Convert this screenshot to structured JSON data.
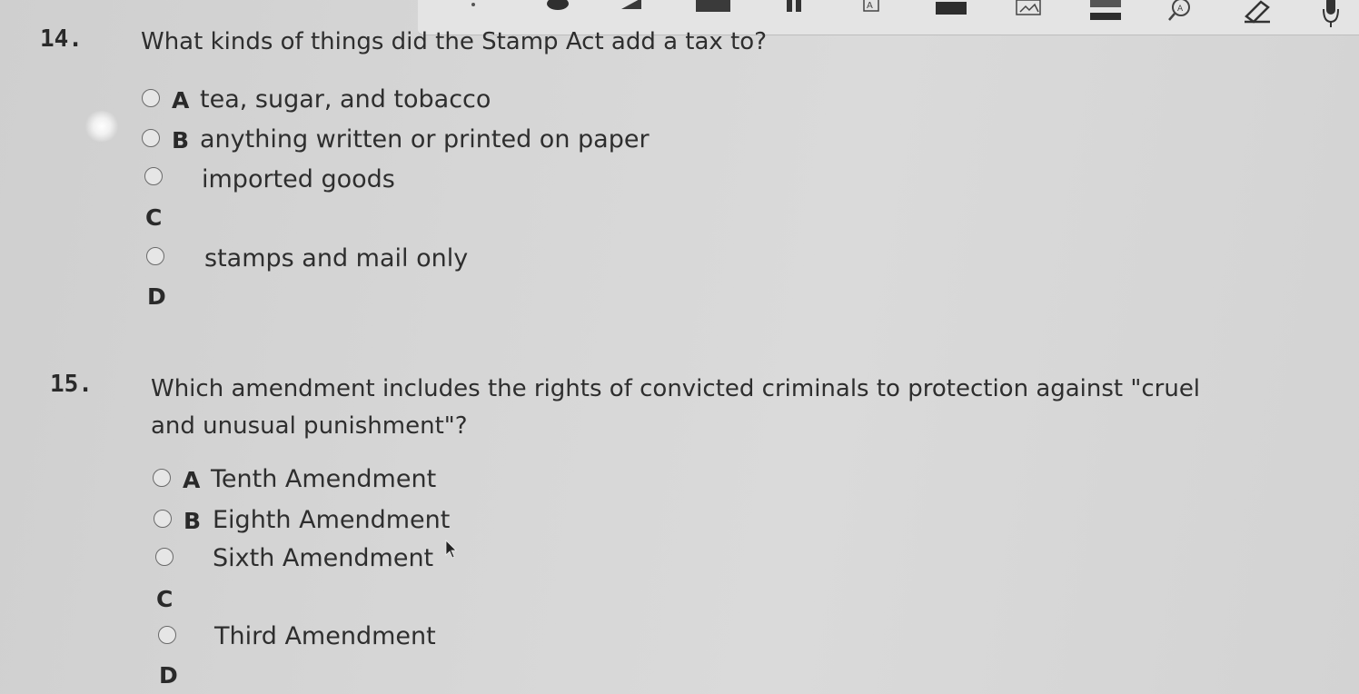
{
  "toolbar": {
    "icons": [
      "pointer-icon",
      "play-icon",
      "highlight-bar-icon",
      "pause-icon",
      "text-box-icon",
      "image-block-icon",
      "image-icon",
      "strikeout-icon",
      "magnify-icon",
      "eraser-pen-icon",
      "microphone-icon"
    ]
  },
  "questions": [
    {
      "number": "14.",
      "text": "What kinds of things did the Stamp Act add a tax to?",
      "options": [
        {
          "letter": "A",
          "text": "tea, sugar, and tobacco"
        },
        {
          "letter": "B",
          "text": "anything written or printed on paper"
        },
        {
          "letter": "C",
          "text": "imported goods"
        },
        {
          "letter": "D",
          "text": "stamps and mail only"
        }
      ]
    },
    {
      "number": "15.",
      "text_line1": "Which amendment includes the rights of convicted criminals to protection against \"cruel",
      "text_line2": "and unusual punishment\"?",
      "options": [
        {
          "letter": "A",
          "text": "Tenth Amendment"
        },
        {
          "letter": "B",
          "text": "Eighth Amendment"
        },
        {
          "letter": "C",
          "text": "Sixth Amendment"
        },
        {
          "letter": "D",
          "text": "Third Amendment"
        }
      ]
    }
  ]
}
